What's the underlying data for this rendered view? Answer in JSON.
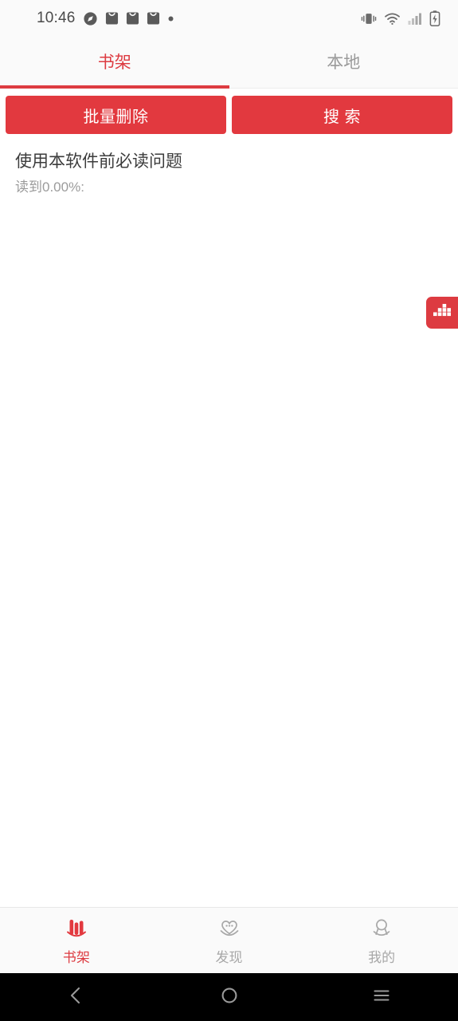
{
  "statusbar": {
    "time": "10:46",
    "left_icons": [
      "compass-icon",
      "mail-icon",
      "mail-icon",
      "mail-icon",
      "dot-icon"
    ],
    "right_icons": [
      "vibrate-icon",
      "wifi-icon",
      "signal-bars-icon",
      "battery-charging-icon"
    ]
  },
  "tabs": [
    {
      "label": "书架",
      "active": true
    },
    {
      "label": "本地",
      "active": false
    }
  ],
  "toolbar": {
    "batch_delete_label": "批量删除",
    "search_label": "搜 索"
  },
  "books": [
    {
      "title": "使用本软件前必读问题",
      "progress": "读到0.00%:"
    }
  ],
  "fab": {
    "icon": "bar-chart-icon"
  },
  "bottom_nav": [
    {
      "label": "书架",
      "icon": "books-icon",
      "active": true
    },
    {
      "label": "发现",
      "icon": "heart-discover-icon",
      "active": false
    },
    {
      "label": "我的",
      "icon": "person-icon",
      "active": false
    }
  ],
  "system_nav": [
    {
      "icon": "back-icon"
    },
    {
      "icon": "home-icon"
    },
    {
      "icon": "recents-icon"
    }
  ],
  "colors": {
    "accent": "#dd3b41",
    "button": "#e2393f",
    "inactive_text": "#9a9a9a",
    "title_text": "#3c3c3c"
  }
}
